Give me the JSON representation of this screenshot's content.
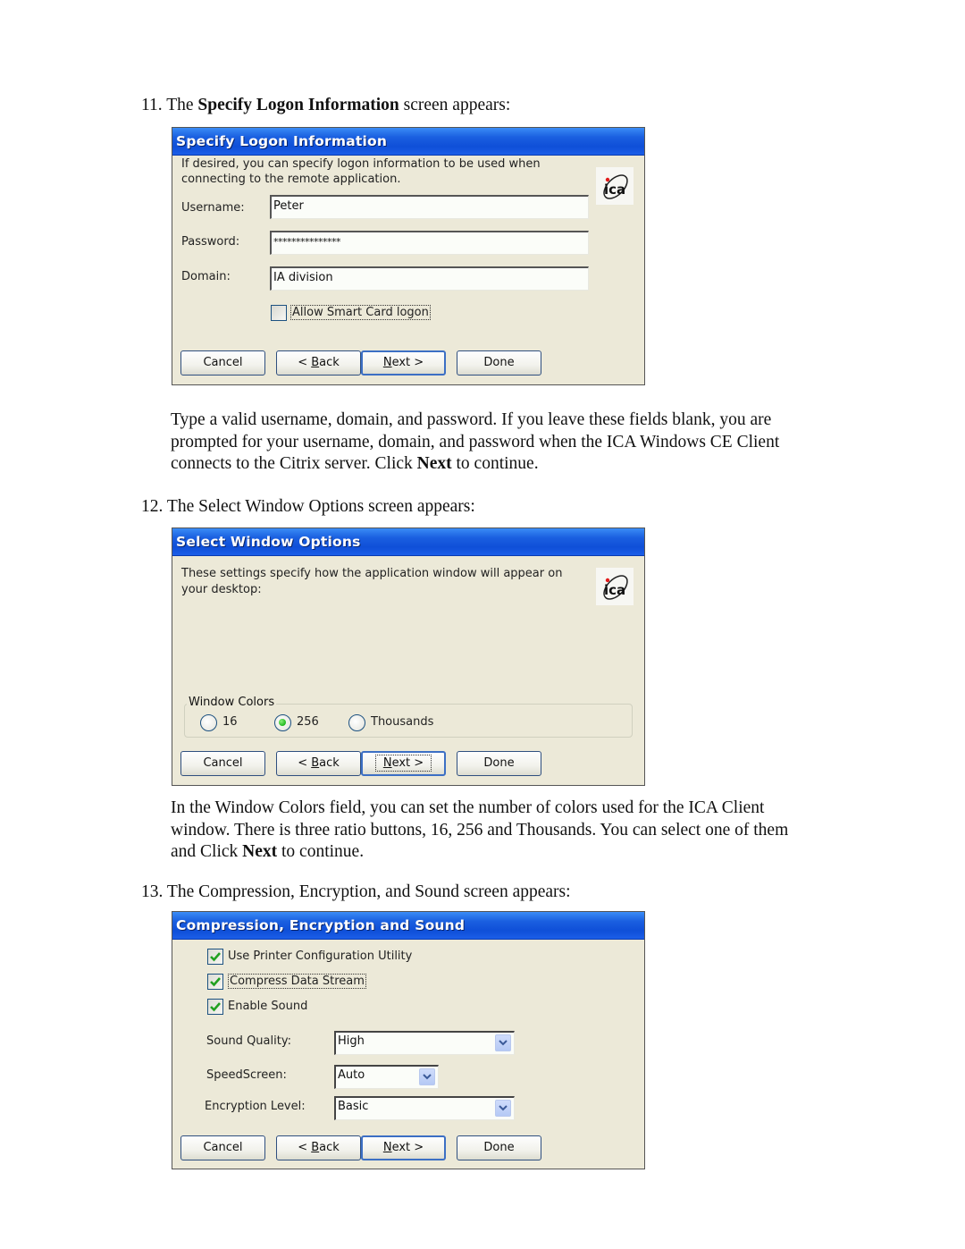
{
  "doc": {
    "step11": {
      "number": "11.",
      "pre": "The",
      "bold": "Specify Logon Information",
      "post": "screen appears:"
    },
    "para11": {
      "line1": "Type a valid username, domain, and password. If you leave these fields blank, you are",
      "line2": "prompted for your username, domain, and password when the ICA Windows CE Client",
      "line3_pre": "connects to the Citrix server. Click",
      "line3_bold": "Next",
      "line3_post": "to continue."
    },
    "step12": {
      "number": "12.",
      "text": "The Select Window Options screen appears:"
    },
    "para12": {
      "line1": "In the Window Colors field, you can set the number of colors used for the ICA Client",
      "line2": "window. There is three ratio buttons, 16, 256 and Thousands. You can select one of them",
      "line3_pre": "and Click",
      "line3_bold": "Next",
      "line3_post": "to continue."
    },
    "step13": {
      "number": "13.",
      "text": "The Compression, Encryption, and Sound screen appears:"
    }
  },
  "buttons": {
    "cancel": "Cancel",
    "back_prefix": "< ",
    "back_access": "B",
    "back_rest": "ack",
    "next_access": "N",
    "next_rest": "ext >",
    "done": "Done"
  },
  "dialog1": {
    "title": "Specify Logon Information",
    "intro_line1": "If desired, you can specify logon information to be used when",
    "intro_line2": "connecting to the remote application.",
    "logo": "ica",
    "username_label": "Username:",
    "username_value": "Peter",
    "password_label": "Password:",
    "password_value": "***************",
    "domain_label": "Domain:",
    "domain_value": "IA division",
    "smartcard_label": "Allow Smart Card logon",
    "smartcard_checked": false
  },
  "dialog2": {
    "title": "Select Window Options",
    "intro_line1": "These settings specify how the application window will appear on",
    "intro_line2": "your desktop:",
    "logo": "ica",
    "group_label": "Window Colors",
    "options": [
      {
        "label": "16",
        "selected": false
      },
      {
        "label": "256",
        "selected": true
      },
      {
        "label": "Thousands",
        "selected": false
      }
    ]
  },
  "dialog3": {
    "title": "Compression, Encryption and Sound",
    "checkboxes": [
      {
        "label": "Use Printer Configuration Utility",
        "checked": true
      },
      {
        "label": "Compress Data Stream",
        "checked": true
      },
      {
        "label": "Enable Sound",
        "checked": true
      }
    ],
    "sound_quality_label": "Sound Quality:",
    "sound_quality_value": "High",
    "speedscreen_label": "SpeedScreen:",
    "speedscreen_value": "Auto",
    "encryption_label": "Encryption Level:",
    "encryption_value": "Basic"
  }
}
